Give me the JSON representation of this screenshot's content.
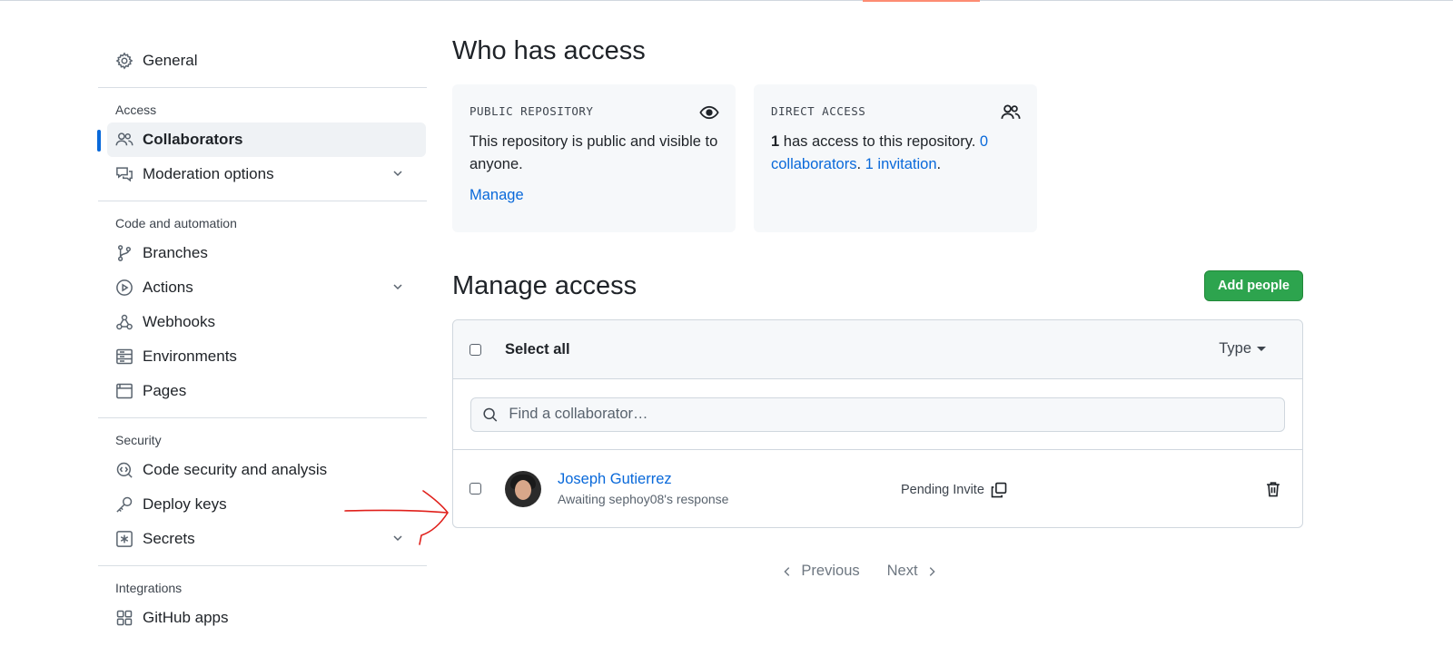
{
  "sidebar": {
    "general": "General",
    "sections": [
      {
        "head": "Access",
        "items": [
          {
            "label": "Collaborators"
          },
          {
            "label": "Moderation options"
          }
        ]
      },
      {
        "head": "Code and automation",
        "items": [
          {
            "label": "Branches"
          },
          {
            "label": "Actions"
          },
          {
            "label": "Webhooks"
          },
          {
            "label": "Environments"
          },
          {
            "label": "Pages"
          }
        ]
      },
      {
        "head": "Security",
        "items": [
          {
            "label": "Code security and analysis"
          },
          {
            "label": "Deploy keys"
          },
          {
            "label": "Secrets"
          }
        ]
      },
      {
        "head": "Integrations",
        "items": [
          {
            "label": "GitHub apps"
          }
        ]
      }
    ]
  },
  "who_has_access": {
    "title": "Who has access",
    "public_card": {
      "title": "PUBLIC REPOSITORY",
      "text": "This repository is public and visible to anyone.",
      "link": "Manage"
    },
    "direct_card": {
      "title": "DIRECT ACCESS",
      "count": "1",
      "text_a": " has access to this repository. ",
      "collaborators_link": "0 collaborators",
      "sep": ". ",
      "invitation_link": "1 invitation",
      "end": "."
    }
  },
  "manage_access": {
    "title": "Manage access",
    "add_button": "Add people",
    "select_all": "Select all",
    "type_filter": "Type",
    "search_placeholder": "Find a collaborator…",
    "rows": [
      {
        "name": "Joseph Gutierrez",
        "sub": "Awaiting sephoy08's response",
        "status": "Pending Invite"
      }
    ]
  },
  "pagination": {
    "previous": "Previous",
    "next": "Next"
  },
  "colors": {
    "accent": "#0969da",
    "green": "#2da44e",
    "annotation": "#e0201b"
  }
}
